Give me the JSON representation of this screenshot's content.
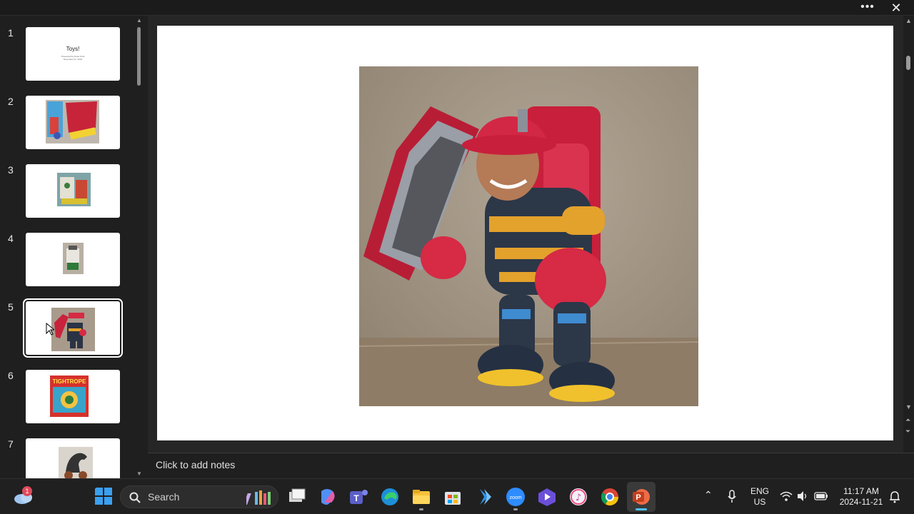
{
  "window": {
    "more_label": "•••",
    "close_label": "✕"
  },
  "thumbnails": [
    {
      "num": "1",
      "title": "Toys!",
      "subtitle_line1": "Presented by Peter Kuhl",
      "subtitle_line2": "November 21, 2024"
    },
    {
      "num": "2"
    },
    {
      "num": "3"
    },
    {
      "num": "4"
    },
    {
      "num": "5",
      "selected": true
    },
    {
      "num": "6",
      "box_text": "TIGHTROPE"
    },
    {
      "num": "7"
    }
  ],
  "notes": {
    "placeholder": "Click to add notes"
  },
  "taskbar": {
    "weather_badge": "1",
    "search_label": "Search",
    "language_line1": "ENG",
    "language_line2": "US",
    "time": "11:17 AM",
    "date": "2024-11-21",
    "zoom_label": "zoom"
  },
  "colors": {
    "accent_powerpoint": "#c43e1c",
    "selection": "#ffffff"
  }
}
